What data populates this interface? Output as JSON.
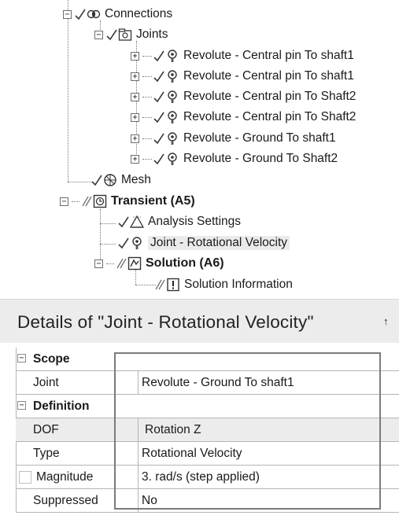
{
  "tree": {
    "connections_label": "Connections",
    "joints_label": "Joints",
    "joints": [
      "Revolute - Central pin To shaft1",
      "Revolute - Central pin To shaft1",
      "Revolute - Central pin To Shaft2",
      "Revolute - Central pin To Shaft2",
      "Revolute - Ground To shaft1",
      "Revolute - Ground To Shaft2"
    ],
    "mesh_label": "Mesh",
    "transient_label": "Transient (A5)",
    "analysis_settings_label": "Analysis Settings",
    "joint_velocity_label": "Joint - Rotational Velocity",
    "solution_label": "Solution (A6)",
    "solution_info_label": "Solution Information"
  },
  "details": {
    "title": "Details of \"Joint - Rotational Velocity\"",
    "pin_glyph": "↑",
    "scope_label": "Scope",
    "joint_label": "Joint",
    "joint_value": "Revolute - Ground To shaft1",
    "definition_label": "Definition",
    "dof_label": "DOF",
    "dof_value": "Rotation Z",
    "type_label": "Type",
    "type_value": "Rotational Velocity",
    "magnitude_label": "Magnitude",
    "magnitude_value": "3. rad/s  (step applied)",
    "suppressed_label": "Suppressed",
    "suppressed_value": "No"
  },
  "expand_glyphs": {
    "plus": "+",
    "minus": "−"
  }
}
